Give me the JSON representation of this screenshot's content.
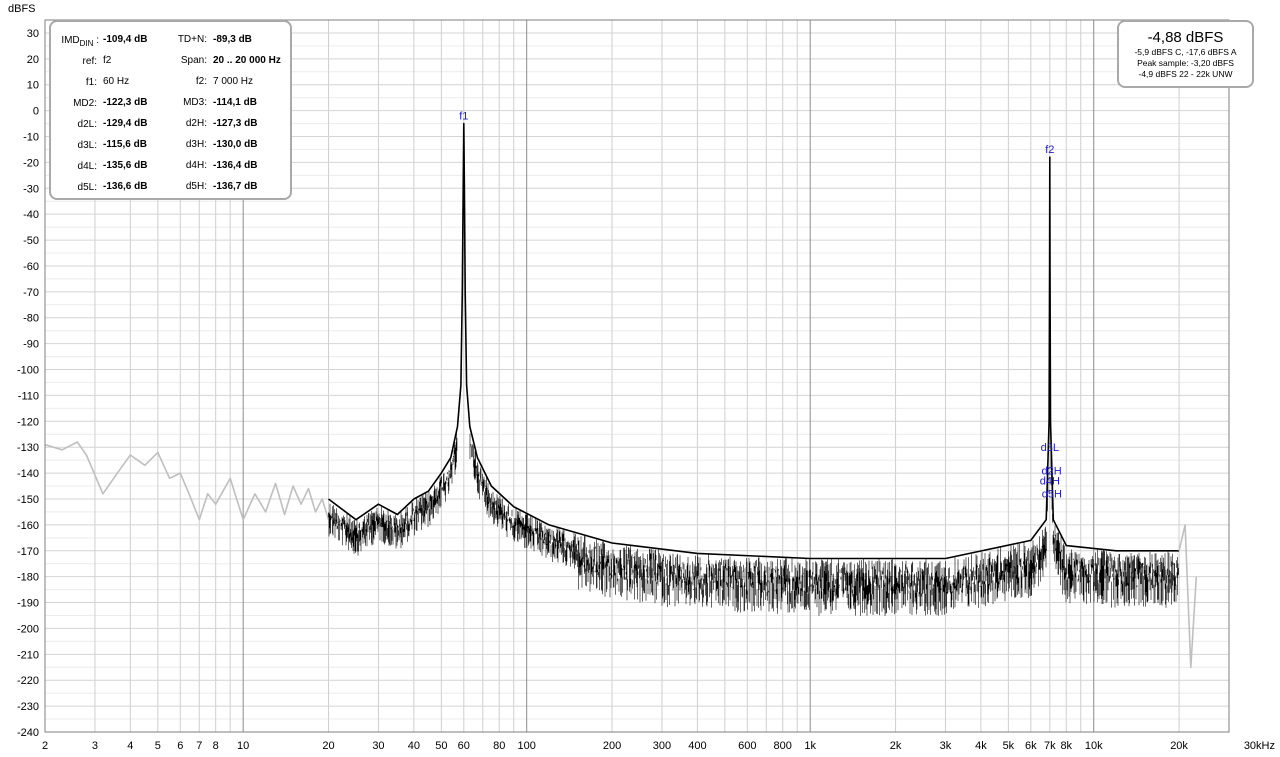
{
  "chart_data": {
    "type": "line",
    "title": "",
    "ylabel": "dBFS",
    "xlabel": "",
    "x_scale": "log",
    "xlim": [
      2,
      30000
    ],
    "ylim": [
      -240,
      35
    ],
    "grid": true,
    "x_tick_labels": [
      {
        "f": 2,
        "label": "2"
      },
      {
        "f": 3,
        "label": "3"
      },
      {
        "f": 4,
        "label": "4"
      },
      {
        "f": 5,
        "label": "5"
      },
      {
        "f": 6,
        "label": "6"
      },
      {
        "f": 7,
        "label": "7"
      },
      {
        "f": 8,
        "label": "8"
      },
      {
        "f": 10,
        "label": "10"
      },
      {
        "f": 20,
        "label": "20"
      },
      {
        "f": 30,
        "label": "30"
      },
      {
        "f": 40,
        "label": "40"
      },
      {
        "f": 50,
        "label": "50"
      },
      {
        "f": 60,
        "label": "60"
      },
      {
        "f": 80,
        "label": "80"
      },
      {
        "f": 100,
        "label": "100"
      },
      {
        "f": 200,
        "label": "200"
      },
      {
        "f": 300,
        "label": "300"
      },
      {
        "f": 400,
        "label": "400"
      },
      {
        "f": 600,
        "label": "600"
      },
      {
        "f": 800,
        "label": "800"
      },
      {
        "f": 1000,
        "label": "1k"
      },
      {
        "f": 2000,
        "label": "2k"
      },
      {
        "f": 3000,
        "label": "3k"
      },
      {
        "f": 4000,
        "label": "4k"
      },
      {
        "f": 5000,
        "label": "5k"
      },
      {
        "f": 6000,
        "label": "6k"
      },
      {
        "f": 7000,
        "label": "7k"
      },
      {
        "f": 8000,
        "label": "8k"
      },
      {
        "f": 10000,
        "label": "10k"
      },
      {
        "f": 20000,
        "label": "20k"
      },
      {
        "f": 30000,
        "label": "30kHz"
      }
    ],
    "y_ticks": [
      30,
      20,
      10,
      0,
      -10,
      -20,
      -30,
      -40,
      -50,
      -60,
      -70,
      -80,
      -90,
      -100,
      -110,
      -120,
      -130,
      -140,
      -150,
      -160,
      -170,
      -180,
      -190,
      -200,
      -210,
      -220,
      -230,
      -240
    ],
    "series": [
      {
        "color": "#bfbfbf",
        "out_of_span": true,
        "points": [
          [
            2,
            -129
          ],
          [
            2.3,
            -131
          ],
          [
            2.6,
            -128
          ],
          [
            2.8,
            -133
          ],
          [
            3.2,
            -148
          ],
          [
            3.6,
            -140
          ],
          [
            4,
            -133
          ],
          [
            4.5,
            -137
          ],
          [
            5,
            -132
          ],
          [
            5.5,
            -142
          ],
          [
            6,
            -140
          ],
          [
            6.5,
            -149
          ],
          [
            7,
            -158
          ],
          [
            7.5,
            -148
          ],
          [
            8,
            -152
          ],
          [
            9,
            -142
          ],
          [
            10,
            -158
          ],
          [
            11,
            -148
          ],
          [
            12,
            -155
          ],
          [
            13,
            -144
          ],
          [
            14,
            -156
          ],
          [
            15,
            -145
          ],
          [
            16,
            -152
          ],
          [
            17,
            -146
          ],
          [
            18,
            -155
          ],
          [
            19,
            -150
          ],
          [
            20,
            -158
          ]
        ]
      },
      {
        "color": "#000000",
        "points": [
          [
            20,
            -150
          ],
          [
            25,
            -158
          ],
          [
            30,
            -152
          ],
          [
            35,
            -156
          ],
          [
            40,
            -150
          ],
          [
            45,
            -147
          ],
          [
            50,
            -140
          ],
          [
            54,
            -134
          ],
          [
            57,
            -122
          ],
          [
            58.6,
            -106
          ],
          [
            59.3,
            -70
          ],
          [
            59.7,
            -30
          ],
          [
            60,
            -5
          ],
          [
            60.3,
            -30
          ],
          [
            60.7,
            -70
          ],
          [
            61.4,
            -106
          ],
          [
            63,
            -122
          ],
          [
            67,
            -134
          ],
          [
            75,
            -145
          ],
          [
            90,
            -153
          ],
          [
            120,
            -160
          ],
          [
            200,
            -167
          ],
          [
            400,
            -171
          ],
          [
            1000,
            -173
          ],
          [
            3000,
            -173
          ],
          [
            6000,
            -166
          ],
          [
            6800,
            -158
          ],
          [
            6960,
            -120
          ],
          [
            6990,
            -60
          ],
          [
            7000,
            -18
          ],
          [
            7010,
            -60
          ],
          [
            7040,
            -120
          ],
          [
            7200,
            -158
          ],
          [
            8000,
            -168
          ],
          [
            12000,
            -170
          ],
          [
            20000,
            -170
          ]
        ]
      },
      {
        "color": "#bfbfbf",
        "out_of_span": true,
        "points": [
          [
            20000,
            -170
          ],
          [
            21000,
            -160
          ],
          [
            22000,
            -215
          ],
          [
            23000,
            -180
          ]
        ]
      }
    ],
    "markers": [
      {
        "label": "f1",
        "f": 60,
        "db": -5
      },
      {
        "label": "f2",
        "f": 7000,
        "db": -18
      },
      {
        "label": "d3L",
        "f": 7000,
        "db": -133
      },
      {
        "label": "d2H",
        "f": 7100,
        "db": -142
      },
      {
        "label": "d4H",
        "f": 7000,
        "db": -146
      },
      {
        "label": "d5H",
        "f": 7120,
        "db": -151
      }
    ]
  },
  "imd_box": {
    "rows": [
      {
        "l_label": "IMD",
        "l_sub": "DIN",
        "l_colon": ":",
        "l_value": "-109,4 dB",
        "r_label": "TD+N:",
        "r_value": "-89,3 dB"
      },
      {
        "l_label": "ref:",
        "l_value": "f2",
        "l_norm": true,
        "r_label": "Span:",
        "r_value": "20 .. 20 000 Hz"
      },
      {
        "l_label": "f1:",
        "l_value": "60 Hz",
        "l_norm": true,
        "r_label": "f2:",
        "r_value": "7 000 Hz",
        "r_norm": true
      },
      {
        "l_label": "MD2:",
        "l_value": "-122,3 dB",
        "r_label": "MD3:",
        "r_value": "-114,1 dB"
      },
      {
        "l_label": "d2L:",
        "l_value": "-129,4 dB",
        "r_label": "d2H:",
        "r_value": "-127,3 dB"
      },
      {
        "l_label": "d3L:",
        "l_value": "-115,6 dB",
        "r_label": "d3H:",
        "r_value": "-130,0 dB"
      },
      {
        "l_label": "d4L:",
        "l_value": "-135,6 dB",
        "r_label": "d4H:",
        "r_value": "-136,4 dB"
      },
      {
        "l_label": "d5L:",
        "l_value": "-136,6 dB",
        "r_label": "d5H:",
        "r_value": "-136,7 dB"
      }
    ]
  },
  "level_box": {
    "main": "-4,88 dBFS",
    "line1": "-5,9 dBFS C, -17,6 dBFS A",
    "line2": "Peak sample: -3,20 dBFS",
    "line3": "-4,9 dBFS 22 - 22k UNW"
  }
}
